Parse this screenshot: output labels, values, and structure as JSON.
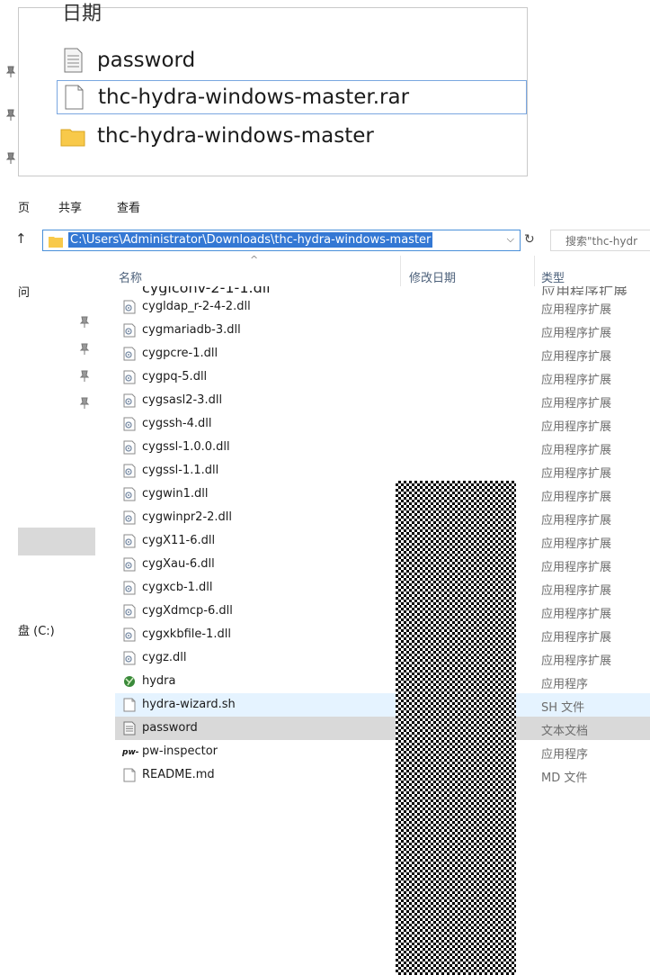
{
  "top_panel": {
    "cut_text": "日期",
    "items": [
      {
        "name": "password",
        "icon": "text-document-icon"
      },
      {
        "name": "thc-hydra-windows-master.rar",
        "icon": "generic-file-icon",
        "selected": true
      },
      {
        "name": "thc-hydra-windows-master",
        "icon": "folder-icon"
      }
    ]
  },
  "ribbon": {
    "tabs": [
      "页",
      "共享",
      "查看"
    ]
  },
  "address": {
    "path": "C:\\Users\\Administrator\\Downloads\\thc-hydra-windows-master",
    "search_placeholder": "搜索\"thc-hydr"
  },
  "nav": {
    "frag_top": "问",
    "drive": "盘 (C:)"
  },
  "columns": {
    "name": "名称",
    "date": "修改日期",
    "type": "类型"
  },
  "cut_row": {
    "name": "cygiconv-2-1-1.dll",
    "type": "应用程序扩展"
  },
  "files": [
    {
      "name": "cygldap_r-2-4-2.dll",
      "type": "应用程序扩展",
      "icon": "dll-icon"
    },
    {
      "name": "cygmariadb-3.dll",
      "type": "应用程序扩展",
      "icon": "dll-icon"
    },
    {
      "name": "cygpcre-1.dll",
      "type": "应用程序扩展",
      "icon": "dll-icon"
    },
    {
      "name": "cygpq-5.dll",
      "type": "应用程序扩展",
      "icon": "dll-icon"
    },
    {
      "name": "cygsasl2-3.dll",
      "type": "应用程序扩展",
      "icon": "dll-icon"
    },
    {
      "name": "cygssh-4.dll",
      "type": "应用程序扩展",
      "icon": "dll-icon"
    },
    {
      "name": "cygssl-1.0.0.dll",
      "type": "应用程序扩展",
      "icon": "dll-icon"
    },
    {
      "name": "cygssl-1.1.dll",
      "type": "应用程序扩展",
      "icon": "dll-icon"
    },
    {
      "name": "cygwin1.dll",
      "type": "应用程序扩展",
      "icon": "dll-icon"
    },
    {
      "name": "cygwinpr2-2.dll",
      "type": "应用程序扩展",
      "icon": "dll-icon"
    },
    {
      "name": "cygX11-6.dll",
      "type": "应用程序扩展",
      "icon": "dll-icon"
    },
    {
      "name": "cygXau-6.dll",
      "type": "应用程序扩展",
      "icon": "dll-icon"
    },
    {
      "name": "cygxcb-1.dll",
      "type": "应用程序扩展",
      "icon": "dll-icon"
    },
    {
      "name": "cygXdmcp-6.dll",
      "type": "应用程序扩展",
      "icon": "dll-icon"
    },
    {
      "name": "cygxkbfile-1.dll",
      "type": "应用程序扩展",
      "icon": "dll-icon"
    },
    {
      "name": "cygz.dll",
      "type": "应用程序扩展",
      "icon": "dll-icon"
    },
    {
      "name": "hydra",
      "type": "应用程序",
      "icon": "hydra-app-icon"
    },
    {
      "name": "hydra-wizard.sh",
      "type": "SH 文件",
      "icon": "generic-file-icon",
      "state": "hover"
    },
    {
      "name": "password",
      "type": "文本文档",
      "icon": "text-document-icon",
      "state": "selected"
    },
    {
      "name": "pw-inspector",
      "type": "应用程序",
      "icon": "pw-inspector-icon"
    },
    {
      "name": "README.md",
      "type": "MD 文件",
      "icon": "generic-file-icon"
    }
  ],
  "colors": {
    "address_highlight": "#3478d4",
    "hover_row": "#e5f3ff",
    "selected_row": "#d9d9d9",
    "folder": "#f8c94a"
  }
}
